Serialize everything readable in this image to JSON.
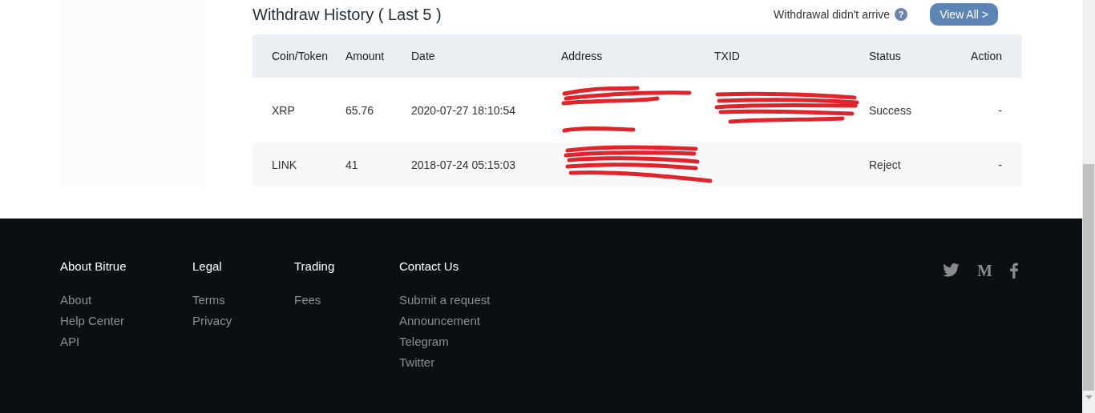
{
  "withdraw_history": {
    "title": "Withdraw History ( Last 5 )",
    "help_link": "Withdrawal didn't arrive",
    "help_glyph": "?",
    "view_all": "View All >",
    "table": {
      "columns": [
        "Coin/Token",
        "Amount",
        "Date",
        "Address",
        "TXID",
        "Status",
        "Action"
      ],
      "rows": [
        {
          "coin": "XRP",
          "amount": "65.76",
          "date": "2020-07-27 18:10:54",
          "address_redacted": true,
          "txid_redacted": true,
          "status": "Success",
          "action": "-"
        },
        {
          "coin": "LINK",
          "amount": "41",
          "date": "2018-07-24 05:15:03",
          "address_redacted": true,
          "txid_redacted": false,
          "status": "Reject",
          "action": "-"
        }
      ]
    }
  },
  "footer": {
    "columns": [
      {
        "heading": "About Bitrue",
        "links": [
          "About",
          "Help Center",
          "API"
        ]
      },
      {
        "heading": "Legal",
        "links": [
          "Terms",
          "Privacy"
        ]
      },
      {
        "heading": "Trading",
        "links": [
          "Fees"
        ]
      },
      {
        "heading": "Contact Us",
        "links": [
          "Submit a request",
          "Announcement",
          "Telegram",
          "Twitter"
        ]
      }
    ],
    "social": [
      {
        "kind": "bird"
      },
      {
        "kind": "glyph",
        "glyph": "M"
      },
      {
        "kind": "f"
      }
    ]
  }
}
